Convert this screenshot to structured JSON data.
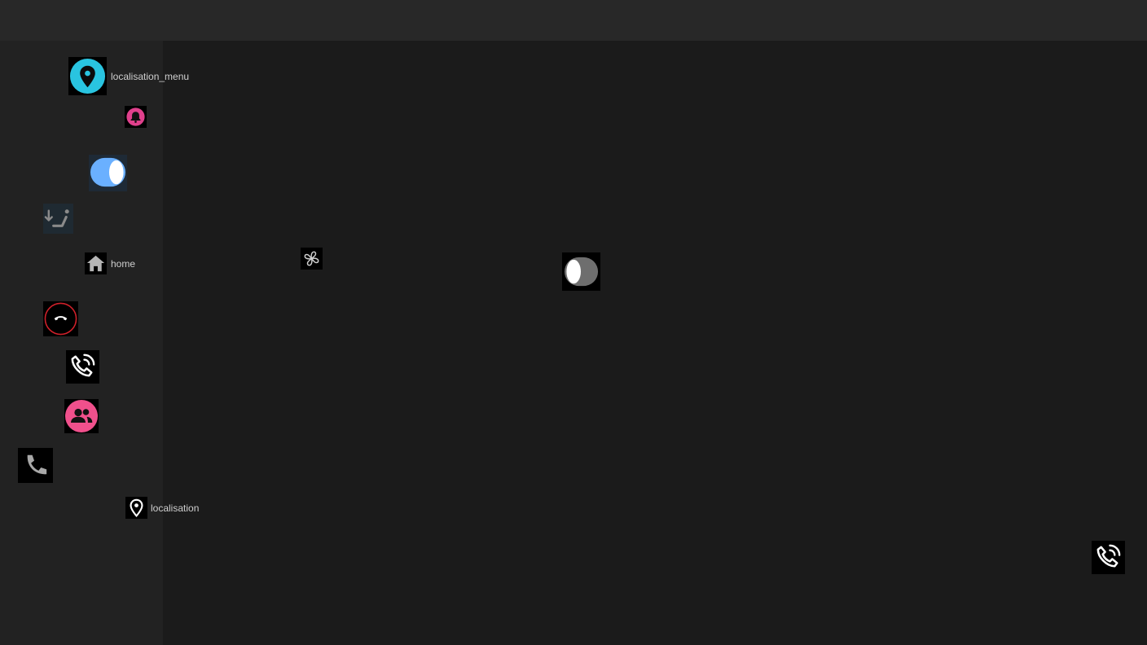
{
  "labels": {
    "localisation_menu": "localisation_menu",
    "home": "home",
    "localisation": "localisation"
  },
  "icons": [
    {
      "name": "map-pin-icon",
      "color": "#29c4e0"
    },
    {
      "name": "bell-icon",
      "color": "#e0408c"
    },
    {
      "name": "toggle-on-icon",
      "color": "#6ab0ff"
    },
    {
      "name": "seat-recline-icon",
      "color": "#8a8a8a"
    },
    {
      "name": "home-icon",
      "color": "#b5b5b5"
    },
    {
      "name": "hang-up-icon",
      "color": "#d0202a"
    },
    {
      "name": "phone-in-talk-icon",
      "color": "#ffffff"
    },
    {
      "name": "contacts-icon",
      "color": "#f0508c"
    },
    {
      "name": "phone-icon",
      "color": "#a8a8a8"
    },
    {
      "name": "location-pin-icon",
      "color": "#ffffff"
    },
    {
      "name": "fan-icon",
      "color": "#cfcfcf"
    },
    {
      "name": "toggle-off-icon",
      "color": "#6e6e6e"
    },
    {
      "name": "phone-in-talk-icon",
      "color": "#ffffff"
    }
  ]
}
